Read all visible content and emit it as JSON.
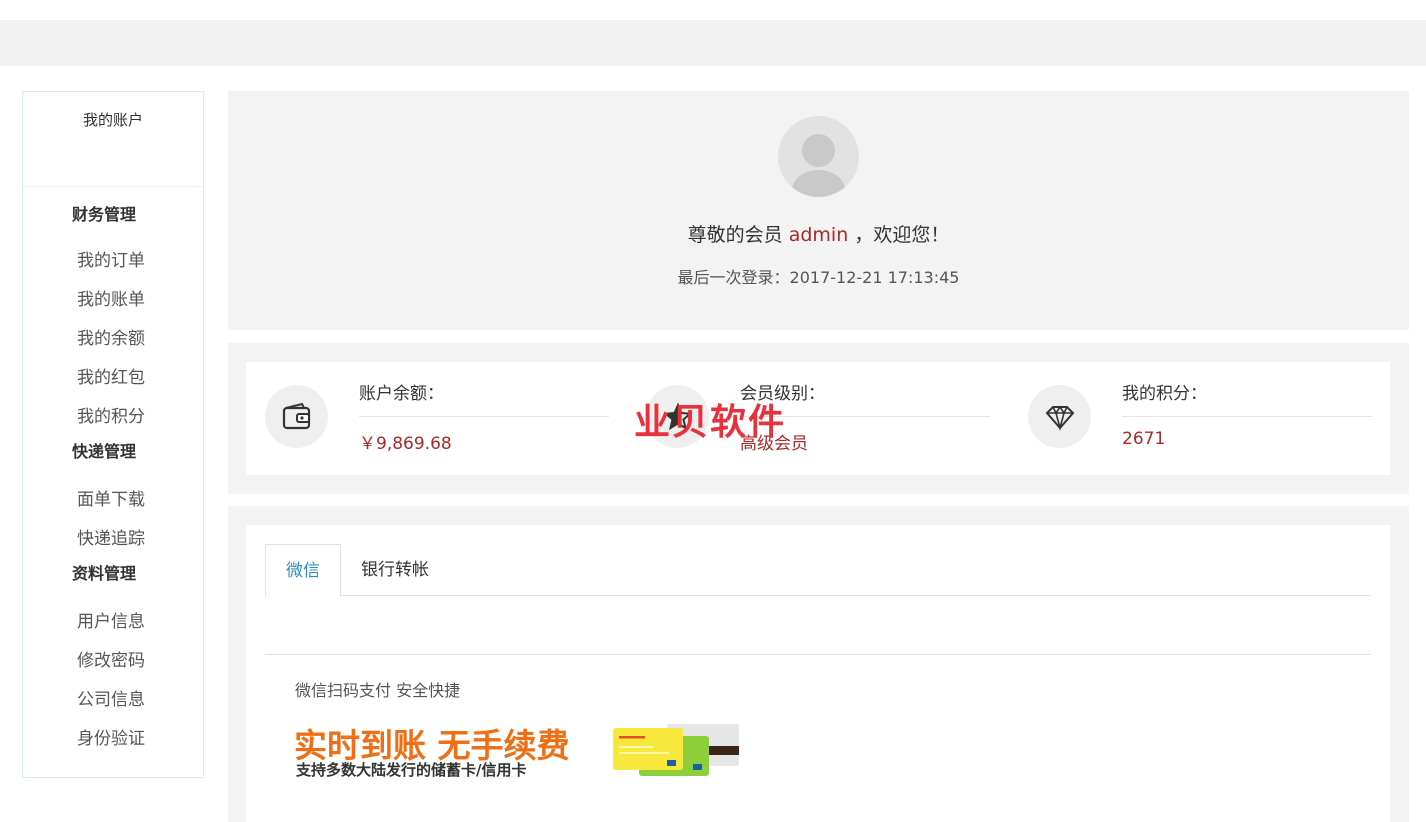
{
  "sidebar": {
    "account": "我的账户",
    "groups": [
      {
        "title": "财务管理",
        "items": [
          "我的订单",
          "我的账单",
          "我的余额",
          "我的红包",
          "我的积分"
        ]
      },
      {
        "title": "快递管理",
        "items": [
          "面单下载",
          "快递追踪"
        ]
      },
      {
        "title": "资料管理",
        "items": [
          "用户信息",
          "修改密码",
          "公司信息",
          "身份验证"
        ]
      }
    ]
  },
  "user": {
    "welcome_prefix": "尊敬的会员",
    "name": "admin",
    "welcome_suffix": "，欢迎您！",
    "last_login": "最后一次登录：2017-12-21 17:13:45"
  },
  "stats": {
    "balance_label": "账户余额：",
    "balance_value": "￥9,869.68",
    "level_label": "会员级别：",
    "level_value": "高级会员",
    "points_label": "我的积分：",
    "points_value": "2671"
  },
  "watermark": "业贝软件",
  "payment": {
    "tabs": [
      "微信",
      "银行转帐"
    ],
    "desc": "微信扫码支付 安全快捷",
    "promo_big": "实时到账 无手续费",
    "promo_small": "支持多数大陆发行的储蓄卡/信用卡"
  },
  "colors": {
    "accent_red": "#a52a2a",
    "tab_active": "#2b8fbf",
    "promo_orange": "#f06e14",
    "watermark": "#e8313a"
  }
}
